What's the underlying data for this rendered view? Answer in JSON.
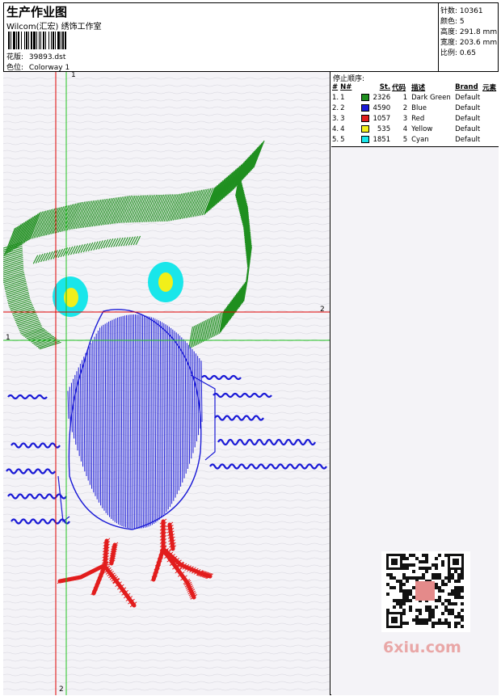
{
  "header": {
    "title": "生产作业图",
    "company": "Wilcom(汇宏) 绣饰工作室",
    "design_label": "花版:",
    "design_value": "39893.dst",
    "colorway_label": "色位:",
    "colorway_value": "Colorway 1"
  },
  "stats": [
    {
      "label": "针数:",
      "value": "10361"
    },
    {
      "label": "颜色:",
      "value": "5"
    },
    {
      "label": "高度:",
      "value": "291.8 mm"
    },
    {
      "label": "宽度:",
      "value": "203.6 mm"
    },
    {
      "label": "比例:",
      "value": "0.65"
    }
  ],
  "stop_sequence": {
    "title": "停止顺序:",
    "columns": [
      "#",
      "N#",
      "St.",
      "代码",
      "描述",
      "Brand",
      "元素"
    ],
    "rows": [
      {
        "num": "1.",
        "n": "1",
        "color": "#1f8f1f",
        "stitches": "2326",
        "code": "1",
        "desc": "Dark Green",
        "brand": "Default"
      },
      {
        "num": "2.",
        "n": "2",
        "color": "#1a1ad6",
        "stitches": "4590",
        "code": "2",
        "desc": "Blue",
        "brand": "Default"
      },
      {
        "num": "3.",
        "n": "3",
        "color": "#e21d1d",
        "stitches": "1057",
        "code": "3",
        "desc": "Red",
        "brand": "Default"
      },
      {
        "num": "4.",
        "n": "4",
        "color": "#f2ef1a",
        "stitches": "535",
        "code": "4",
        "desc": "Yellow",
        "brand": "Default"
      },
      {
        "num": "5.",
        "n": "5",
        "color": "#19e6ea",
        "stitches": "1851",
        "code": "5",
        "desc": "Cyan",
        "brand": "Default"
      }
    ]
  },
  "guides": {
    "v_red_top": "1",
    "v_red_bottom": "2",
    "h_red_right": "2",
    "h_green_left": "1"
  },
  "watermark": "6xiu.com",
  "colors": {
    "green": "#1f8f1f",
    "blue": "#1a1ad6",
    "red": "#e21d1d",
    "yellow": "#f2ef1a",
    "cyan": "#19e6ea",
    "guide_red": "#e00000",
    "guide_green": "#22c322"
  }
}
